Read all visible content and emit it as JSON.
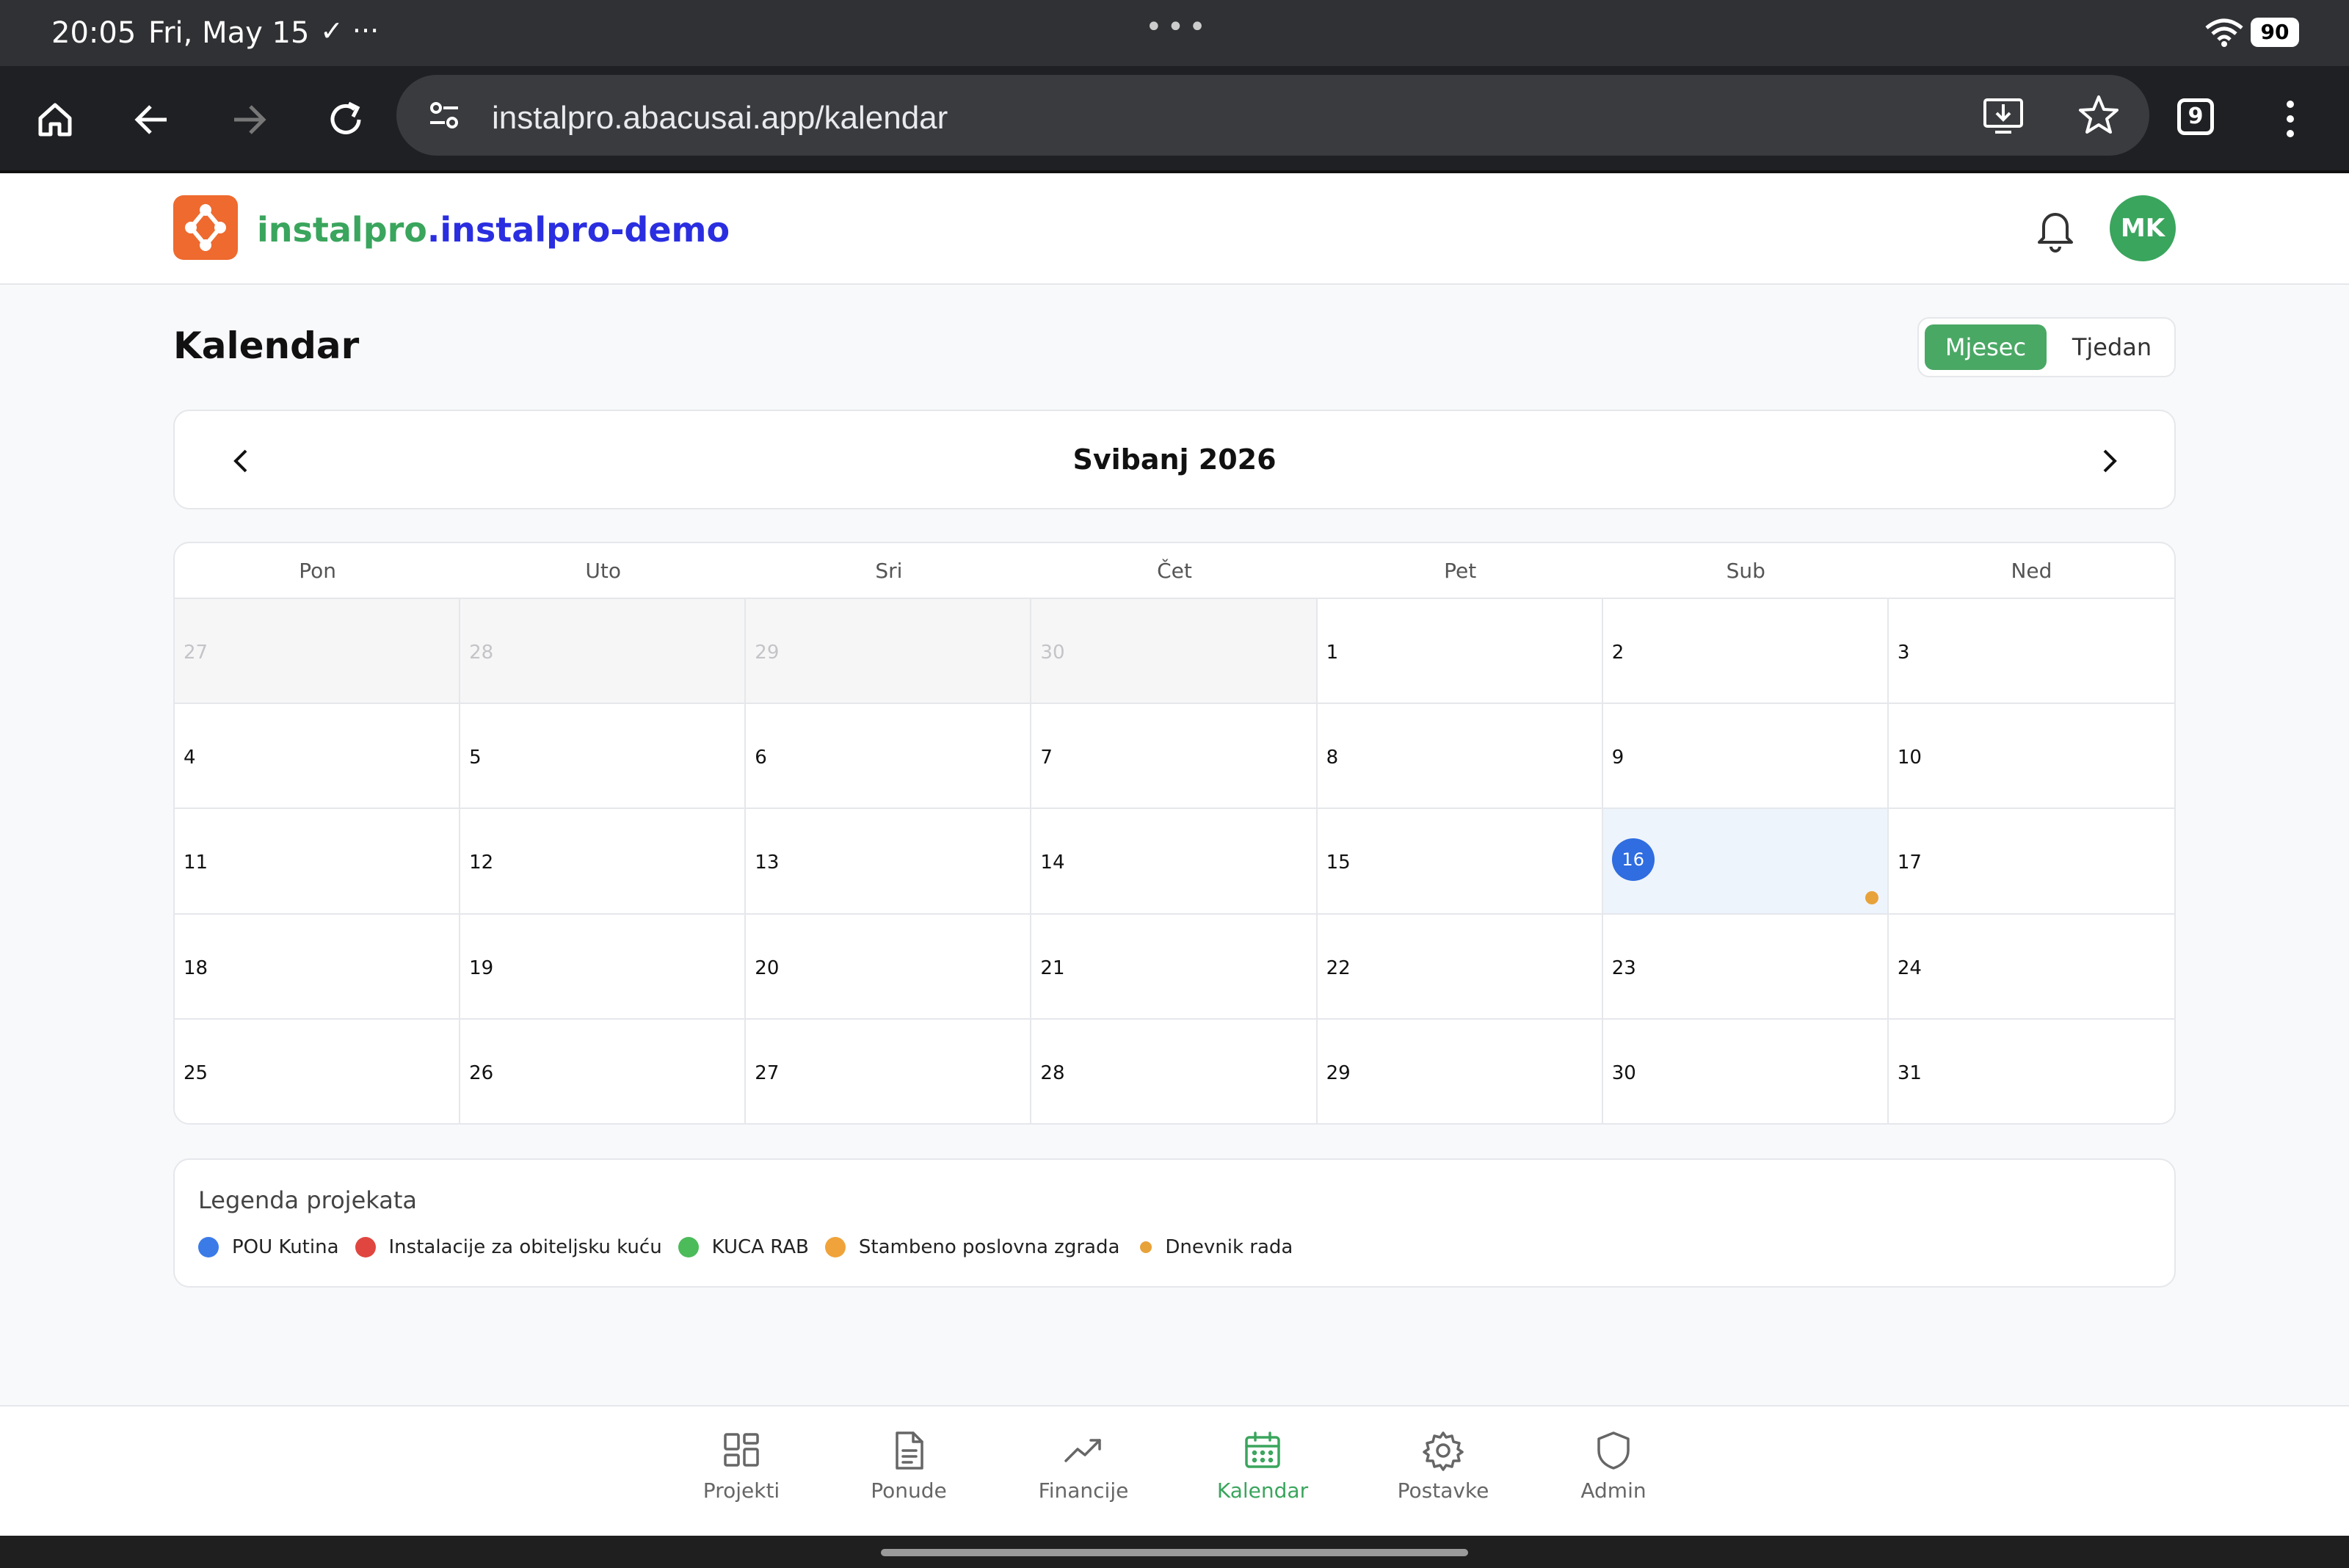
{
  "status_bar": {
    "time": "20:05",
    "date": "Fri, May 15",
    "notif_icons": "✓ ···",
    "battery": "90"
  },
  "browser": {
    "url": "instalpro.abacusai.app/kalendar",
    "tab_count": "9"
  },
  "header": {
    "brand_part1": "instalpro",
    "brand_separator": ".",
    "brand_part2": "instalpro-demo",
    "avatar_initials": "MK",
    "accent_color": "#3aa55d",
    "brand_color_2": "#2a2ee0"
  },
  "page": {
    "title": "Kalendar",
    "view_toggle": {
      "month_label": "Mjesec",
      "week_label": "Tjedan",
      "selected": "Mjesec"
    }
  },
  "calendar": {
    "month_title": "Svibanj 2026",
    "weekdays": [
      "Pon",
      "Uto",
      "Sri",
      "Čet",
      "Pet",
      "Sub",
      "Ned"
    ],
    "days": [
      {
        "n": "27",
        "outside": true
      },
      {
        "n": "28",
        "outside": true
      },
      {
        "n": "29",
        "outside": true
      },
      {
        "n": "30",
        "outside": true
      },
      {
        "n": "1"
      },
      {
        "n": "2"
      },
      {
        "n": "3"
      },
      {
        "n": "4"
      },
      {
        "n": "5"
      },
      {
        "n": "6"
      },
      {
        "n": "7"
      },
      {
        "n": "8"
      },
      {
        "n": "9"
      },
      {
        "n": "10"
      },
      {
        "n": "11"
      },
      {
        "n": "12"
      },
      {
        "n": "13"
      },
      {
        "n": "14"
      },
      {
        "n": "15"
      },
      {
        "n": "16",
        "today": true,
        "event_color": "#e8a23a"
      },
      {
        "n": "17"
      },
      {
        "n": "18"
      },
      {
        "n": "19"
      },
      {
        "n": "20"
      },
      {
        "n": "21"
      },
      {
        "n": "22"
      },
      {
        "n": "23"
      },
      {
        "n": "24"
      },
      {
        "n": "25"
      },
      {
        "n": "26"
      },
      {
        "n": "27"
      },
      {
        "n": "28"
      },
      {
        "n": "29"
      },
      {
        "n": "30"
      },
      {
        "n": "31"
      }
    ]
  },
  "legend": {
    "title": "Legenda projekata",
    "items": [
      {
        "label": "POU Kutina",
        "color": "#3b7be8"
      },
      {
        "label": "Instalacije za obiteljsku kuću",
        "color": "#e0463f"
      },
      {
        "label": "KUCA RAB",
        "color": "#4cbb5a"
      },
      {
        "label": "Stambeno poslovna zgrada",
        "color": "#f0a33a"
      },
      {
        "label": "Dnevnik rada",
        "color": "#e8a23a",
        "small": true
      }
    ]
  },
  "bottom_nav": {
    "items": [
      {
        "label": "Projekti",
        "icon": "grid-icon"
      },
      {
        "label": "Ponude",
        "icon": "document-icon"
      },
      {
        "label": "Financije",
        "icon": "trend-icon"
      },
      {
        "label": "Kalendar",
        "icon": "calendar-icon",
        "active": true
      },
      {
        "label": "Postavke",
        "icon": "gear-icon"
      },
      {
        "label": "Admin",
        "icon": "shield-icon"
      }
    ]
  }
}
